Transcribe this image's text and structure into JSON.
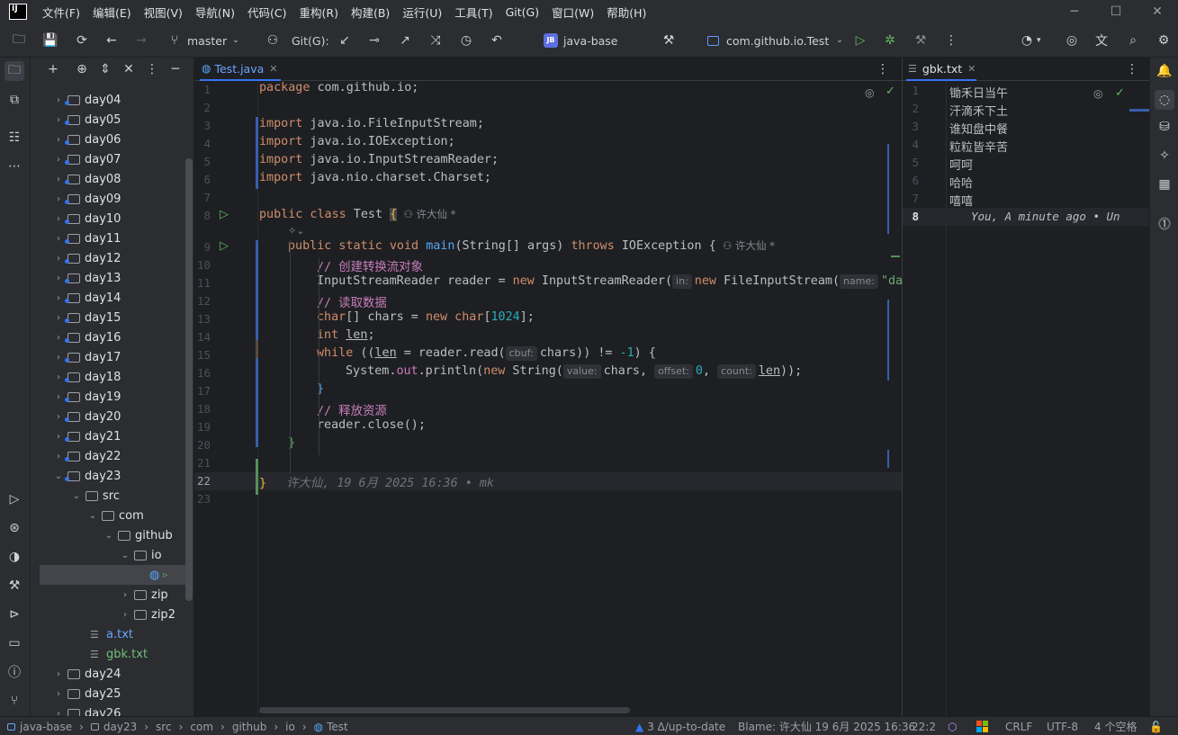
{
  "menu": {
    "items": [
      "文件(F)",
      "编辑(E)",
      "视图(V)",
      "导航(N)",
      "代码(C)",
      "重构(R)",
      "构建(B)",
      "运行(U)",
      "工具(T)",
      "Git(G)",
      "窗口(W)",
      "帮助(H)"
    ]
  },
  "toolbar": {
    "branch": "master",
    "git_label": "Git(G):",
    "project_badge": "JB",
    "project": "java-base",
    "run_config": "com.github.io.Test"
  },
  "project_tree": [
    {
      "label": "day04",
      "kind": "folder"
    },
    {
      "label": "day05",
      "kind": "folder"
    },
    {
      "label": "day06",
      "kind": "folder"
    },
    {
      "label": "day07",
      "kind": "folder"
    },
    {
      "label": "day08",
      "kind": "folder"
    },
    {
      "label": "day09",
      "kind": "folder"
    },
    {
      "label": "day10",
      "kind": "folder"
    },
    {
      "label": "day11",
      "kind": "folder"
    },
    {
      "label": "day12",
      "kind": "folder"
    },
    {
      "label": "day13",
      "kind": "folder"
    },
    {
      "label": "day14",
      "kind": "folder"
    },
    {
      "label": "day15",
      "kind": "folder"
    },
    {
      "label": "day16",
      "kind": "folder"
    },
    {
      "label": "day17",
      "kind": "folder"
    },
    {
      "label": "day18",
      "kind": "folder"
    },
    {
      "label": "day19",
      "kind": "folder"
    },
    {
      "label": "day20",
      "kind": "folder"
    },
    {
      "label": "day21",
      "kind": "folder"
    },
    {
      "label": "day22",
      "kind": "folder"
    },
    {
      "label": "day23",
      "kind": "folder"
    },
    {
      "label": "src",
      "kind": "folder"
    },
    {
      "label": "com",
      "kind": "folder"
    },
    {
      "label": "github",
      "kind": "folder"
    },
    {
      "label": "io",
      "kind": "folder"
    },
    {
      "label": "",
      "kind": "class"
    },
    {
      "label": "zip",
      "kind": "folder"
    },
    {
      "label": "zip2",
      "kind": "folder"
    },
    {
      "label": "a.txt",
      "kind": "file"
    },
    {
      "label": "gbk.txt",
      "kind": "file"
    },
    {
      "label": "day24",
      "kind": "folder"
    },
    {
      "label": "day25",
      "kind": "folder"
    },
    {
      "label": "day26",
      "kind": "folder"
    }
  ],
  "editor": {
    "tab": "Test.java",
    "author_hint": "许大仙 *",
    "blame_line": "许大仙, 19 6月 2025 16:36 • mk",
    "hints": {
      "in": "in:",
      "name": "name:",
      "cbuf": "cbuf:",
      "value": "value:",
      "offset": "offset:",
      "count": "count:"
    },
    "line_numbers": [
      "1",
      "2",
      "3",
      "4",
      "5",
      "6",
      "7",
      "8",
      "9",
      "10",
      "11",
      "12",
      "13",
      "14",
      "15",
      "16",
      "17",
      "18",
      "19",
      "20",
      "21",
      "22",
      "23"
    ],
    "code": {
      "l1_kw": "package",
      "l1_rest": " com.github.io;",
      "l3_kw": "import",
      "l3_rest": " java.io.FileInputStream;",
      "l4_kw": "import",
      "l4_rest": " java.io.IOException;",
      "l5_kw": "import",
      "l5_rest": " java.io.InputStreamReader;",
      "l6_kw": "import",
      "l6_rest": " java.nio.charset.Charset;",
      "l8_kw": "public class",
      "l8_name": " Test ",
      "l8_brace": "{",
      "l9_kw1": "public static void",
      "l9_fn": "main",
      "l9_args": "(String[] args) ",
      "l9_kw2": "throws",
      "l9_rest": " IOException {",
      "l10": "// 创建转换流对象",
      "l11_a": "InputStreamReader reader = ",
      "l11_kw": "new",
      "l11_b": " InputStreamReader(",
      "l11_kw2": "new",
      "l11_c": " FileInputStream(",
      "l11_str": "\"da",
      "l12": "// 读取数据",
      "l13_kw": "char",
      "l13_a": "[] chars = ",
      "l13_kw2": "new",
      "l13_kw3": " char",
      "l13_b": "[",
      "l13_num": "1024",
      "l13_c": "];",
      "l14_kw": "int",
      "l14_var": "len",
      "l14_end": ";",
      "l15_kw": "while",
      "l15_a": " ((",
      "l15_var": "len",
      "l15_b": " = reader.read(",
      "l15_c": "chars)) != ",
      "l15_num": "-1",
      "l15_d": ") {",
      "l16_a": "System.",
      "l16_fld": "out",
      "l16_b": ".println(",
      "l16_kw": "new",
      "l16_c": " String(",
      "l16_d": "chars, ",
      "l16_num": "0",
      "l16_e": ", ",
      "l16_var": "len",
      "l16_f": "));",
      "l17": "}",
      "l18": "// 释放资源",
      "l19": "reader.close();",
      "l20": "}",
      "l22": "}"
    }
  },
  "editor2": {
    "tab": "gbk.txt",
    "line_numbers": [
      "1",
      "2",
      "3",
      "4",
      "5",
      "6",
      "7",
      "8"
    ],
    "lines": [
      "锄禾日当午",
      "汗滴禾下土",
      "谁知盘中餐",
      "粒粒皆辛苦",
      "呵呵",
      "哈哈",
      "嘻嘻"
    ],
    "blame": "You, A minute ago • Un"
  },
  "statusbar": {
    "crumbs": [
      "java-base",
      "day23",
      "src",
      "com",
      "github",
      "io",
      "Test"
    ],
    "vcs": "3 Δ/up-to-date",
    "blame": "Blame: 许大仙 19 6月 2025 16:36",
    "position": "22:2",
    "line_sep": "CRLF",
    "encoding": "UTF-8",
    "indent": "4 个空格"
  },
  "colors": {
    "accent": "#3574f0",
    "keyword": "#cf8e6d",
    "function": "#56a8f5",
    "comment": "#c77dbb",
    "number": "#2aacb8",
    "run": "#5fb865"
  }
}
